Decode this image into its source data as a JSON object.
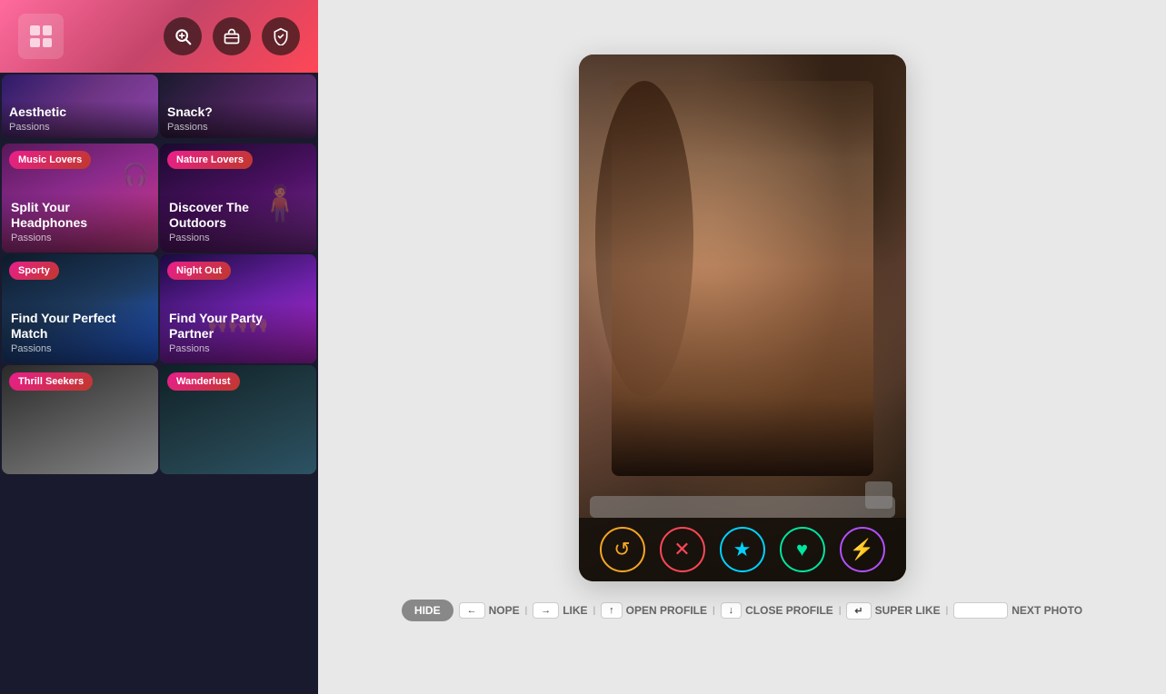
{
  "sidebar": {
    "logo_alt": "App Logo",
    "header_bg": "linear-gradient(135deg, #ff6b9d, #c44569, #ff4757)",
    "icons": [
      {
        "name": "search-icon",
        "label": "Search"
      },
      {
        "name": "briefcase-icon",
        "label": "Briefcase"
      },
      {
        "name": "shield-icon",
        "label": "Shield"
      }
    ],
    "top_cards": [
      {
        "id": "aesthetic",
        "title": "Aesthetic",
        "subtitle": "Passions",
        "badge": null,
        "bg_class": "card-aesthetic"
      },
      {
        "id": "snack",
        "title": "Snack?",
        "subtitle": "Passions",
        "badge": null,
        "bg_class": "card-snack"
      }
    ],
    "cards": [
      {
        "id": "music-lovers",
        "badge": "Music Lovers",
        "title": "Split Your Headphones",
        "subtitle": "Passions",
        "bg_class": "card-music"
      },
      {
        "id": "nature-lovers",
        "badge": "Nature Lovers",
        "title": "Discover The Outdoors",
        "subtitle": "Passions",
        "bg_class": "card-nature"
      },
      {
        "id": "sporty",
        "badge": "Sporty",
        "title": "Find Your Perfect Match",
        "subtitle": "Passions",
        "bg_class": "card-sporty"
      },
      {
        "id": "night-out",
        "badge": "Night Out",
        "title": "Find Your Party Partner",
        "subtitle": "Passions",
        "bg_class": "card-nightout"
      },
      {
        "id": "thrill-seekers",
        "badge": "Thrill Seekers",
        "title": "",
        "subtitle": "",
        "bg_class": "card-thrill"
      },
      {
        "id": "wanderlust",
        "badge": "Wanderlust",
        "title": "",
        "subtitle": "",
        "bg_class": "card-wanderlust"
      }
    ]
  },
  "profile": {
    "action_buttons": [
      {
        "id": "rewind",
        "icon": "↺",
        "label": "Rewind",
        "class": "btn-rewind"
      },
      {
        "id": "nope",
        "icon": "✕",
        "label": "Nope",
        "class": "btn-nope"
      },
      {
        "id": "like",
        "icon": "★",
        "label": "Like",
        "class": "btn-like"
      },
      {
        "id": "heart",
        "icon": "♥",
        "label": "Heart",
        "class": "btn-heart"
      },
      {
        "id": "boost",
        "icon": "⚡",
        "label": "Boost",
        "class": "btn-boost"
      }
    ]
  },
  "shortcuts": {
    "hide_label": "HIDE",
    "items": [
      {
        "key": "←",
        "label": "NOPE"
      },
      {
        "key": "→",
        "label": "LIKE"
      },
      {
        "key": "↑",
        "label": "OPEN PROFILE"
      },
      {
        "key": "↓",
        "label": "CLOSE PROFILE"
      },
      {
        "key": "↵",
        "label": "SUPER LIKE"
      },
      {
        "key": "",
        "label": "NEXT PHOTO"
      }
    ]
  }
}
